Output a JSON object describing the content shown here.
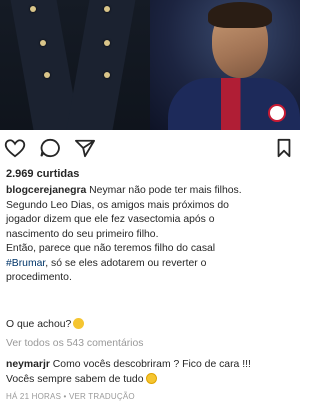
{
  "post": {
    "likes": "2.969 curtidas",
    "caption_user": "blogcerejanegra",
    "caption_line1": " Neymar não pode ter mais filhos.",
    "caption_line2": "Segundo Leo Dias, os amigos mais próximos do",
    "caption_line3": "jogador dizem que ele fez vasectomia após o",
    "caption_line4": "nascimento do seu primeiro filho.",
    "caption_line5": "Então, parece que não teremos filho do casal",
    "caption_hashtag": "#Brumar",
    "caption_line6_rest": ", só se eles adotarem ou reverter o",
    "caption_line7": "procedimento.",
    "question": "O que achou?",
    "question_emoji": "thinking-face-emoji",
    "view_all_comments": "Ver todos os 543 comentários"
  },
  "comment": {
    "user": "neymarjr",
    "text_line1": " Como vocês descobriram ? Fico de cara !!!",
    "text_line2": "Vocês sempre sabem de tudo",
    "emoji": "fearful-face-emoji",
    "time": "HÁ 21 HORAS",
    "separator": " • ",
    "translate": "VER TRADUÇÃO"
  },
  "icons": {
    "like": "heart-icon",
    "comment": "comment-icon",
    "share": "send-icon",
    "save": "bookmark-icon"
  },
  "colors": {
    "text": "#262626",
    "muted": "#999999",
    "hashtag": "#003569"
  }
}
